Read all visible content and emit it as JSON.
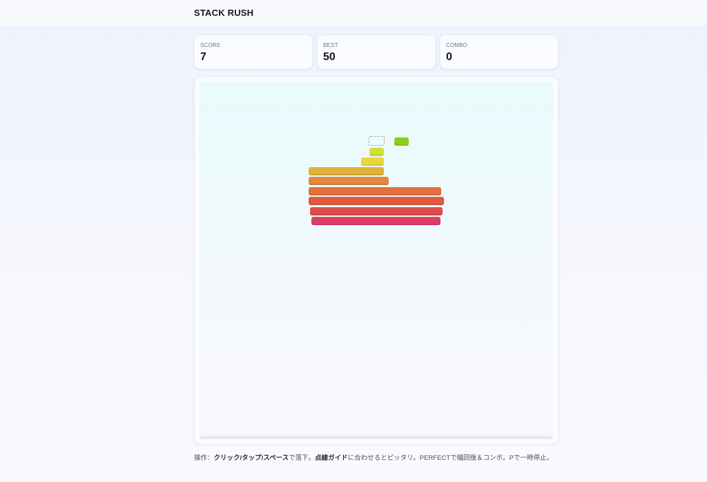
{
  "app": {
    "title": "STACK RUSH"
  },
  "stats": {
    "score": {
      "label": "SCORE",
      "value": "7"
    },
    "best": {
      "label": "BEST",
      "value": "50"
    },
    "combo": {
      "label": "COMBO",
      "value": "0"
    }
  },
  "game": {
    "drop_progress": 0,
    "stack": [
      {
        "color": "#de3e62"
      },
      {
        "color": "#e04b4e"
      },
      {
        "color": "#e2583f"
      },
      {
        "color": "#e2703d"
      },
      {
        "color": "#e2873f"
      },
      {
        "color": "#e0b23b"
      },
      {
        "color": "#e6d83a"
      },
      {
        "color": "#cfe032"
      }
    ],
    "moving_block": {
      "color": "#8dce1d"
    },
    "guide": {
      "style": "dashed",
      "color": "#9aa7b8"
    }
  },
  "help": {
    "prefix": "操作：",
    "controls": "クリック/タップ/スペース",
    "drop": "で落下。",
    "guide": "点線ガイド",
    "guide_suffix": "に合わせるとピッタリ。PERFECTで幅回復＆コンボ。Pで一時停止。"
  }
}
